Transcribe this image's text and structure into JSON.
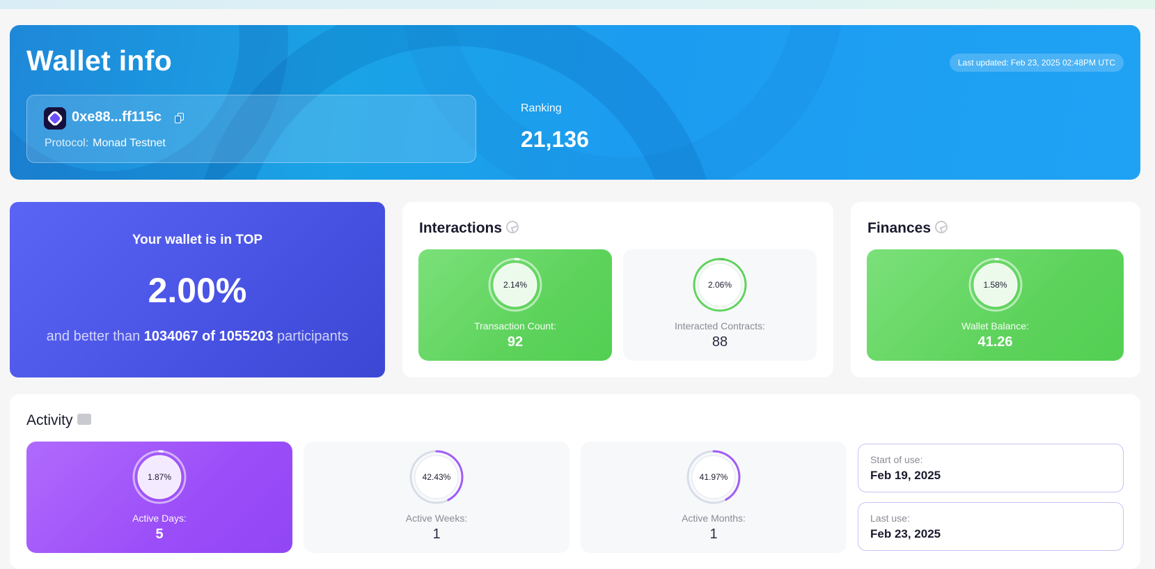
{
  "header": {
    "title": "Wallet info",
    "last_updated": "Last updated: Feb 23, 2025 02:48PM UTC",
    "address": "0xe88...ff115c",
    "protocol_label": "Protocol:",
    "protocol_value": "Monad Testnet",
    "ranking_label": "Ranking",
    "ranking_value": "21,136"
  },
  "top": {
    "line1": "Your wallet is in TOP",
    "percent": "2.00%",
    "line3_prefix": "and better than ",
    "line3_bold": "1034067 of 1055203",
    "line3_suffix": " participants"
  },
  "interactions": {
    "title": "Interactions",
    "stats": [
      {
        "label": "Transaction Count:",
        "value": "92",
        "percent_text": "2.14%",
        "percent": 2.14
      },
      {
        "label": "Interacted Contracts:",
        "value": "88",
        "percent_text": "2.06%",
        "percent": 2.06
      }
    ]
  },
  "finances": {
    "title": "Finances",
    "stats": [
      {
        "label": "Wallet Balance:",
        "value": "41.26",
        "percent_text": "1.58%",
        "percent": 1.58
      }
    ]
  },
  "activity": {
    "title": "Activity",
    "stats": [
      {
        "label": "Active Days:",
        "value": "5",
        "percent_text": "1.87%",
        "percent": 1.87
      },
      {
        "label": "Active Weeks:",
        "value": "1",
        "percent_text": "42.43%",
        "percent": 42.43
      },
      {
        "label": "Active Months:",
        "value": "1",
        "percent_text": "41.97%",
        "percent": 41.97
      }
    ],
    "start_label": "Start of use:",
    "start_value": "Feb 19, 2025",
    "last_label": "Last use:",
    "last_value": "Feb 23, 2025"
  },
  "colors": {
    "banner": "#1c9cf0",
    "top_card": "#4b55e6",
    "green": "#5ed35c",
    "purple": "#9b4ef8",
    "ring_green": "#5ed35c",
    "ring_purple": "#a05cf7"
  }
}
